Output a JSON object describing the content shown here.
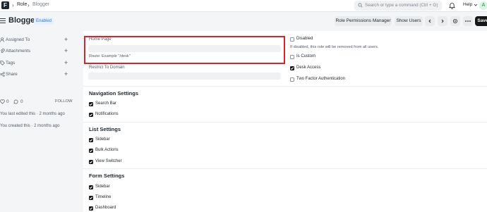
{
  "navbar": {
    "logo": "F",
    "breadcrumbs": [
      "Role",
      "Blogger"
    ],
    "search_placeholder": "Search or type a command (Ctrl + G)",
    "help_label": "Help",
    "avatar_initial": "A"
  },
  "header": {
    "title": "Blogger",
    "status_badge": "Enabled",
    "role_permissions_manager": "Role Permissions Manager",
    "show_users": "Show Users",
    "save": "Save"
  },
  "sidebar": {
    "items": [
      {
        "label": "Assigned To",
        "icon": "user-add-icon"
      },
      {
        "label": "Attachments",
        "icon": "paperclip-icon"
      },
      {
        "label": "Tags",
        "icon": "tag-icon"
      },
      {
        "label": "Share",
        "icon": "share-icon"
      }
    ],
    "like_count": "0",
    "comment_count": "0",
    "follow": "FOLLOW",
    "last_edited": "You last edited this · 2 months ago",
    "created": "You created this · 2 months ago"
  },
  "form": {
    "home_page_label": "Home Page",
    "home_page_value": "",
    "route_help": "Route: Example \"/desk\"",
    "restrict_to_domain_label": "Restrict To Domain",
    "restrict_to_domain_value": "",
    "disabled_label": "Disabled",
    "disabled_checked": false,
    "disabled_help": "If disabled, this role will be removed from all users.",
    "is_custom_label": "Is Custom",
    "is_custom_checked": false,
    "desk_access_label": "Desk Access",
    "desk_access_checked": true,
    "two_factor_label": "Two Factor Authentication",
    "two_factor_checked": false
  },
  "sections": {
    "navigation": {
      "title": "Navigation Settings",
      "items": [
        "Search Bar",
        "Notifications"
      ]
    },
    "list": {
      "title": "List Settings",
      "items": [
        "Sidebar",
        "Bulk Actions",
        "View Switcher"
      ]
    },
    "form": {
      "title": "Form Settings",
      "items": [
        "Sidebar",
        "Timeline",
        "Dashboard"
      ]
    }
  },
  "colors": {
    "accent": "#171717",
    "highlight": "#d8232a",
    "badge": "#2b7cdb"
  }
}
